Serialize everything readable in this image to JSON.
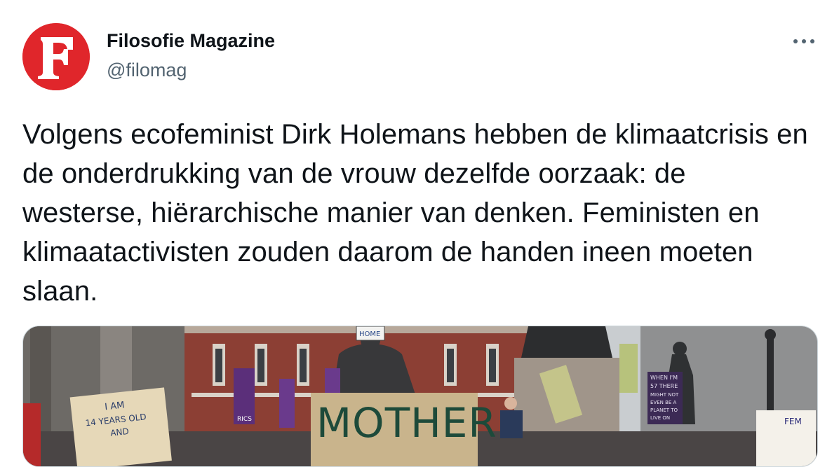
{
  "tweet": {
    "author_name": "Filosofie Magazine",
    "author_handle": "@filomag",
    "avatar_letter": "F",
    "more_icon": "ellipsis-horizontal-icon",
    "text": "Volgens ecofeminist Dirk Holemans hebben de klimaatcrisis en de onderdrukking van de vrouw dezelfde oorzaak: de westerse, hiërarchische manier van denken. Feministen en klimaatactivisten zouden daarom de handen ineen moeten slaan."
  },
  "media": {
    "signs": {
      "home": "HOME",
      "mother": "MOTHER",
      "age_line1": "I AM",
      "age_line2": "14 YEARS OLD",
      "age_line3": "AND",
      "banner": "RICS",
      "when_line1": "WHEN I'M",
      "when_line2": "57 THERE",
      "when_line3": "MIGHT NOT",
      "when_line4": "EVEN BE A",
      "when_line5": "PLANET TO",
      "when_line6": "LIVE ON",
      "fem": "FEM"
    }
  },
  "colors": {
    "avatar_red": "#e0262b",
    "handle_gray": "#536471",
    "text": "#0f1419",
    "border": "#cfd9de"
  }
}
